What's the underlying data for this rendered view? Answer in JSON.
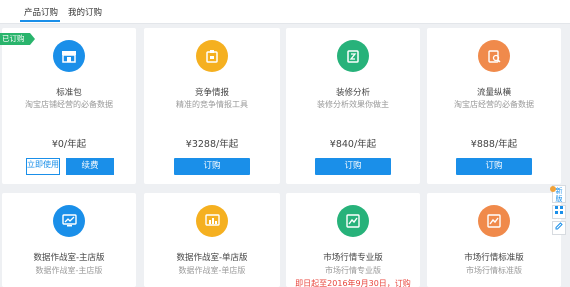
{
  "tabs": [
    {
      "label": "产品订购"
    },
    {
      "label": "我的订购"
    }
  ],
  "subscribed_badge": "已订购",
  "cards": [
    {
      "title": "标准包",
      "desc": "淘宝店铺经营的必备数据",
      "price": "¥0/年起",
      "actions": [
        "立即使用",
        "续费"
      ],
      "color": "#1a8fe9",
      "icon": "shop-icon"
    },
    {
      "title": "竞争情报",
      "desc": "精准的竞争情报工具",
      "price": "¥3288/年起",
      "action": "订购",
      "color": "#f5b020",
      "icon": "badge-icon"
    },
    {
      "title": "装修分析",
      "desc": "装修分析效果你做主",
      "price": "¥840/年起",
      "action": "订购",
      "color": "#27b27a",
      "icon": "decor-icon"
    },
    {
      "title": "流量纵横",
      "desc": "淘宝店经营的必备数据",
      "price": "¥888/年起",
      "action": "订购",
      "color": "#f08a4b",
      "icon": "traffic-search-icon"
    },
    {
      "title": "数据作战室-主店版",
      "desc": "数据作战室-主店版",
      "color": "#1a8fe9",
      "icon": "monitor-chart-icon"
    },
    {
      "title": "数据作战室-单店版",
      "desc": "数据作战室-单店版",
      "color": "#f5b020",
      "icon": "bar-chart-icon"
    },
    {
      "title": "市场行情专业版",
      "desc": "市场行情专业版",
      "promo": "即日起至2016年9月30日，订购",
      "color": "#27b27a",
      "icon": "trend-icon"
    },
    {
      "title": "市场行情标准版",
      "desc": "市场行情标准版",
      "color": "#f08a4b",
      "icon": "trend-icon"
    }
  ],
  "side_tools": [
    "新版",
    "",
    ""
  ]
}
